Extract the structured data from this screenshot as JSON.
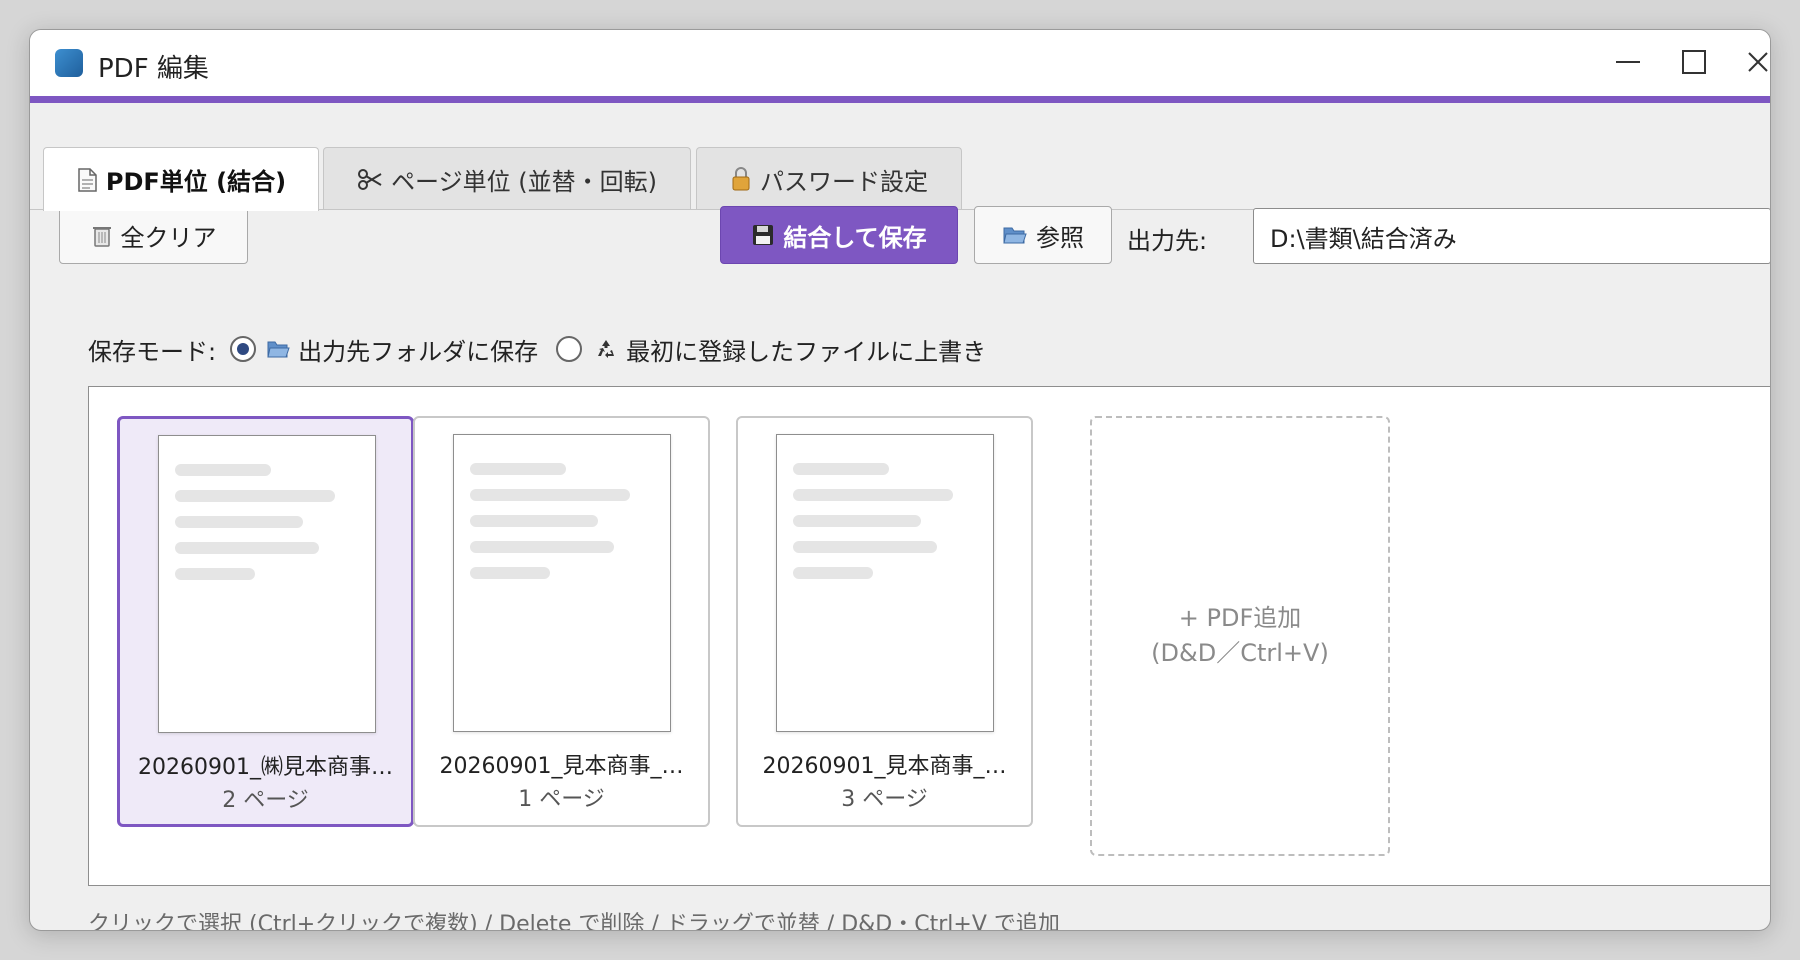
{
  "window": {
    "title": "PDF 編集",
    "controls": {
      "minimize": "minimize",
      "maximize": "maximize",
      "close": "close"
    }
  },
  "colors": {
    "accent": "#7e57c2",
    "window_bg": "#efefef",
    "radio_dot": "#2f4a82"
  },
  "tabs": [
    {
      "icon": "document-icon",
      "label": "PDF単位 (結合)",
      "active": true
    },
    {
      "icon": "scissors-icon",
      "label": "ページ単位 (並替・回転)",
      "active": false
    },
    {
      "icon": "lock-icon",
      "label": "パスワード設定",
      "active": false
    }
  ],
  "toolbar": {
    "clear_label": "全クリア",
    "save_label": "結合して保存",
    "browse_label": "参照",
    "output_label": "出力先:",
    "output_path": "D:\\書類\\結合済み"
  },
  "save_mode": {
    "label": "保存モード:",
    "options": [
      {
        "label": "出力先フォルダに保存",
        "checked": true
      },
      {
        "label": "最初に登録したファイルに上書き",
        "checked": false
      }
    ]
  },
  "files": [
    {
      "name": "20260901_㈱見本商事…",
      "pages": "2 ページ",
      "selected": true
    },
    {
      "name": "20260901_見本商事_…",
      "pages": "1 ページ",
      "selected": false
    },
    {
      "name": "20260901_見本商事_…",
      "pages": "3 ページ",
      "selected": false
    }
  ],
  "add_card": {
    "line1": "+ PDF追加",
    "line2": "(D&D／Ctrl+V)"
  },
  "status_hint": "クリックで選択 (Ctrl+クリックで複数) / Delete で削除 / ドラッグで並替 / D&D・Ctrl+V で追加"
}
